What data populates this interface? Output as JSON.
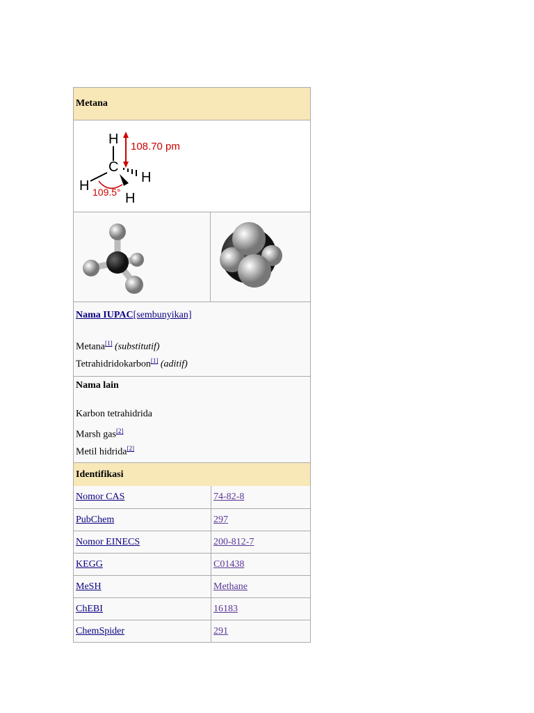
{
  "title": "Metana",
  "structure": {
    "bond_length": "108.70 pm",
    "angle": "109.5°",
    "atoms": {
      "c": "C",
      "h": "H"
    }
  },
  "iupac": {
    "label": "Nama IUPAC",
    "toggle": "[sembunyikan]",
    "names": [
      {
        "name": "Metana",
        "ref": "[1]",
        "type": "(substitutif)"
      },
      {
        "name": "Tetrahidridokarbon",
        "ref": "[1]",
        "type": "(aditif)"
      }
    ]
  },
  "other": {
    "label": "Nama lain",
    "names": [
      {
        "name": "Karbon tetrahidrida",
        "ref": ""
      },
      {
        "name": "Marsh gas",
        "ref": "[2]"
      },
      {
        "name": "Metil hidrida",
        "ref": "[2]"
      }
    ]
  },
  "ident": {
    "label": "Identifikasi",
    "rows": [
      {
        "k": "Nomor CAS",
        "v": "74-82-8"
      },
      {
        "k": "PubChem",
        "v": "297"
      },
      {
        "k": "Nomor EINECS",
        "v": "200-812-7"
      },
      {
        "k": "KEGG",
        "v": "C01438"
      },
      {
        "k": "MeSH",
        "v": "Methane"
      },
      {
        "k": "ChEBI",
        "v": "16183"
      },
      {
        "k": "ChemSpider",
        "v": "291"
      }
    ]
  }
}
